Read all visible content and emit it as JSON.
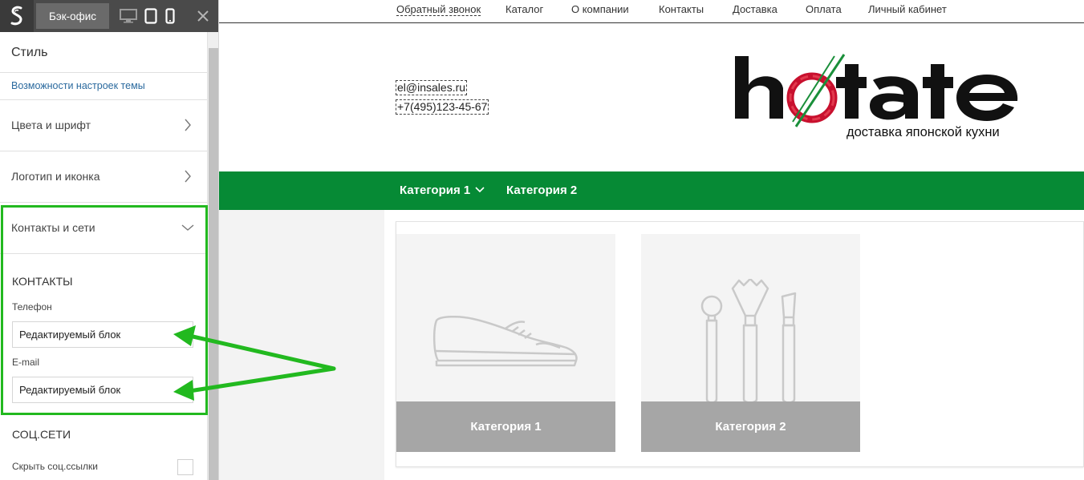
{
  "editor": {
    "topbar": {
      "backoffice_label": "Бэк-офис",
      "devices": [
        "desktop-icon",
        "tablet-icon",
        "mobile-icon"
      ]
    },
    "title": "Стиль",
    "theme_link": "Возможности настроек темы",
    "menu": [
      {
        "label": "Цвета и шрифт",
        "state": "collapsed"
      },
      {
        "label": "Логотип и иконка",
        "state": "collapsed"
      },
      {
        "label": "Контакты и сети",
        "state": "expanded"
      }
    ],
    "contacts": {
      "section_title": "КОНТАКТЫ",
      "phone_label": "Телефон",
      "phone_value": "Редактируемый блок",
      "email_label": "E-mail",
      "email_value": "Редактируемый блок"
    },
    "social": {
      "section_title": "СОЦ.СЕТИ",
      "hide_label": "Скрыть соц.ссылки",
      "hide_checked": false
    },
    "highlight_color": "#22b91f"
  },
  "preview": {
    "top_nav": [
      "Обратный звонок",
      "Каталог",
      "О компании",
      "Контакты",
      "Доставка",
      "Оплата",
      "Личный кабинет"
    ],
    "contacts": {
      "email": "el@insales.ru",
      "phone": "+7(495)123-45-67"
    },
    "brand": {
      "name": "hotate",
      "tagline": "доставка японской кухни"
    },
    "category_bar": {
      "color": "#068a35",
      "items": [
        "Категория 1",
        "Категория 2"
      ]
    },
    "cards": [
      {
        "label": "Категория 1",
        "icon": "shoe-icon"
      },
      {
        "label": "Категория 2",
        "icon": "brushes-icon"
      }
    ]
  }
}
